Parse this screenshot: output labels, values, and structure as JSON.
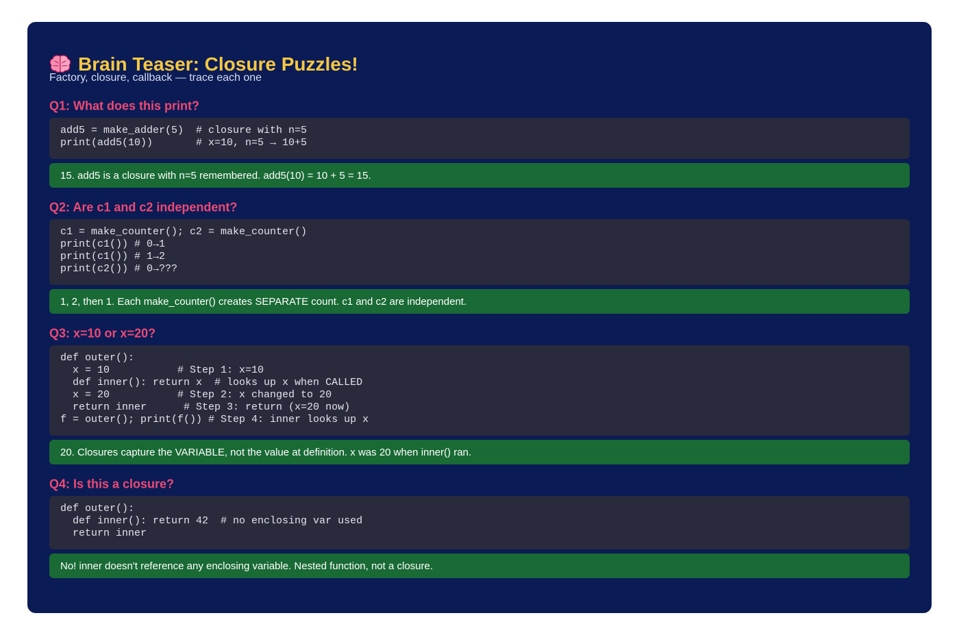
{
  "header": {
    "title": "Brain Teaser: Closure Puzzles!",
    "title_icon": "brain-emoji",
    "subtitle": "Factory, closure, callback — trace each one"
  },
  "colors": {
    "panel_background": "#0b1b55",
    "title": "#f5c842",
    "question": "#ec4a74",
    "code_background": "#2a2a3d",
    "answer_background": "#196a35"
  },
  "questions": [
    {
      "heading": "Q1: What does this print?",
      "code": "add5 = make_adder(5)  # closure with n=5\nprint(add5(10))       # x=10, n=5 → 10+5",
      "answer": "15. add5 is a closure with n=5 remembered. add5(10) = 10 + 5 = 15."
    },
    {
      "heading": "Q2: Are c1 and c2 independent?",
      "code": "c1 = make_counter(); c2 = make_counter()\nprint(c1()) # 0→1\nprint(c1()) # 1→2\nprint(c2()) # 0→???",
      "answer": "1, 2, then 1. Each make_counter() creates SEPARATE count. c1 and c2 are independent."
    },
    {
      "heading": "Q3: x=10 or x=20?",
      "code": "def outer():\n  x = 10           # Step 1: x=10\n  def inner(): return x  # looks up x when CALLED\n  x = 20           # Step 2: x changed to 20\n  return inner      # Step 3: return (x=20 now)\nf = outer(); print(f()) # Step 4: inner looks up x",
      "answer": "20. Closures capture the VARIABLE, not the value at definition. x was 20 when inner() ran."
    },
    {
      "heading": "Q4: Is this a closure?",
      "code": "def outer():\n  def inner(): return 42  # no enclosing var used\n  return inner",
      "answer": "No! inner doesn't reference any enclosing variable. Nested function, not a closure."
    }
  ]
}
